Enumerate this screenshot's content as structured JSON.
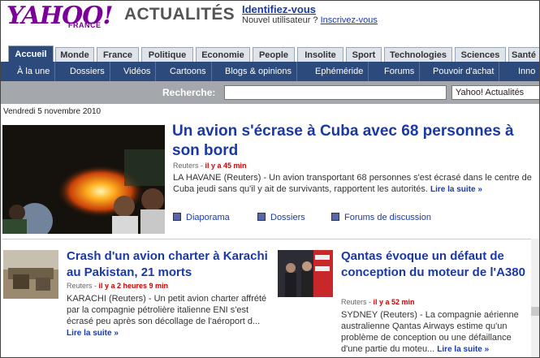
{
  "header": {
    "logo_text": "YAHOO!",
    "logo_sub": "FRANCE",
    "section": "ACTUALITÉS",
    "signin_label": "Identifiez-vous",
    "newuser_text": "Nouvel utilisateur ? ",
    "register_label": "Inscrivez-vous"
  },
  "tabs": [
    {
      "label": "Accueil",
      "active": true
    },
    {
      "label": "Monde"
    },
    {
      "label": "France"
    },
    {
      "label": "Politique"
    },
    {
      "label": "Economie"
    },
    {
      "label": "People"
    },
    {
      "label": "Insolite"
    },
    {
      "label": "Sport"
    },
    {
      "label": "Technologies"
    },
    {
      "label": "Sciences"
    },
    {
      "label": "Santé"
    }
  ],
  "subnav": [
    "À la une",
    "Dossiers",
    "Vidéos",
    "Cartoons",
    "Blogs & opinions",
    "Ephéméride",
    "Forums",
    "Pouvoir d'achat",
    "Inno"
  ],
  "search": {
    "label": "Recherche:",
    "value": "",
    "scope": "Yahoo! Actualités"
  },
  "date": "Vendredi 5 novembre 2010",
  "lead": {
    "title": "Un avion s'écrase à Cuba avec 68 personnes à son bord",
    "source": "Reuters",
    "time": "il y a 45 min",
    "body": "LA HAVANE (Reuters) - Un avion transportant 68 personnes s'est écrasé dans le centre de Cuba jeudi sans qu'il y ait de survivants, rapportent les autorités.",
    "readmore": "Lire la suite »",
    "links": [
      "Diaporama",
      "Dossiers",
      "Forums de discussion"
    ]
  },
  "stories": [
    {
      "title": "Crash d'un avion charter à Karachi au Pakistan, 21 morts",
      "source": "Reuters",
      "time": "il y a 2 heures 9 min",
      "body": "KARACHI (Reuters) - Un petit avion charter affrété par la compagnie pétrolière italienne ENI s'est écrasé peu après son décollage de l'aéroport d...",
      "readmore": "Lire la suite »"
    },
    {
      "title": "Qantas évoque un défaut de conception du moteur de l'A380",
      "source": "Reuters",
      "time": "il y a 52 min",
      "body": "SYDNEY (Reuters) - La compagnie aérienne australienne Qantas Airways estime qu'un problème de conception ou une défaillance d'une partie du moteu...",
      "readmore": "Lire la suite »"
    }
  ],
  "colors": {
    "brand": "#7b0099",
    "link": "#1a39a8",
    "nav": "#2d4a7c",
    "time": "#cc0000"
  }
}
